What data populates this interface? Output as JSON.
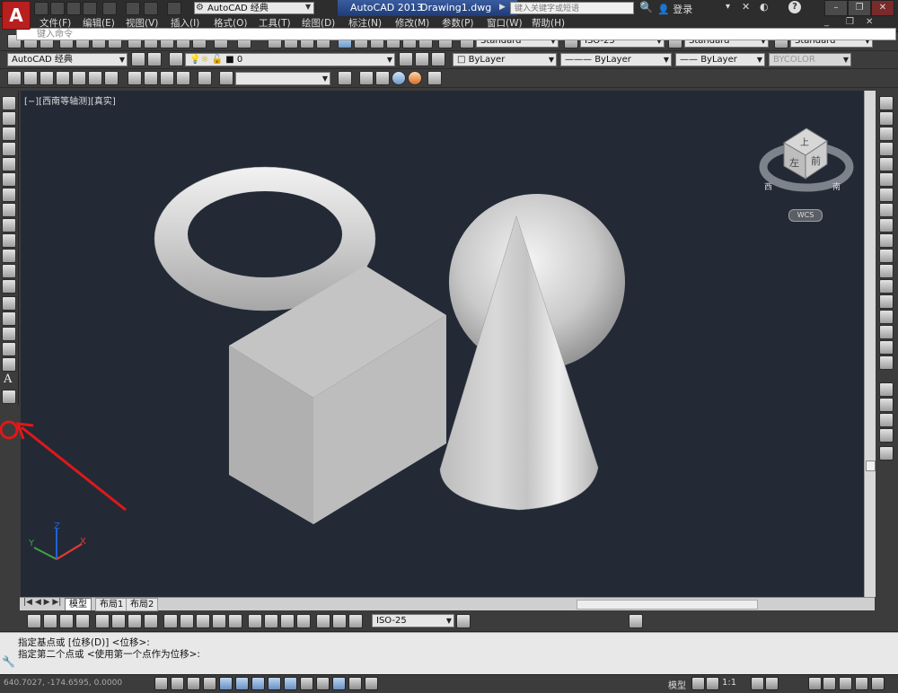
{
  "title_bar": {
    "app_logo": "A",
    "workspace": "AutoCAD 经典",
    "app_name": "AutoCAD 2013",
    "document_name": "Drawing1.dwg",
    "search_placeholder": "键入关键字或短语",
    "login_label": "登录",
    "help_label": "?"
  },
  "menu": {
    "items": [
      "文件(F)",
      "编辑(E)",
      "视图(V)",
      "插入(I)",
      "格式(O)",
      "工具(T)",
      "绘图(D)",
      "标注(N)",
      "修改(M)",
      "参数(P)",
      "窗口(W)",
      "帮助(H)"
    ]
  },
  "styles_toolbar": {
    "text_style": "Standard",
    "dim_style": "ISO-25",
    "table_style": "Standard",
    "multileader_style": "Standard"
  },
  "layers_toolbar": {
    "workspace": "AutoCAD 经典",
    "layer": "0",
    "color": "ByLayer",
    "linetype": "ByLayer",
    "lineweight": "ByLayer",
    "plotstyle": "BYCOLOR"
  },
  "viewport": {
    "label": "[−][西南等轴测][真实]",
    "viewcube_top": "上",
    "viewcube_left": "左",
    "viewcube_front": "前",
    "compass_west": "西",
    "compass_south": "南",
    "wcs_label": "WCS",
    "ucs_x": "X",
    "ucs_y": "Y",
    "ucs_z": "Z"
  },
  "tabs": {
    "model": "模型",
    "layout1": "布局1",
    "layout2": "布局2"
  },
  "dim_toolbar": {
    "dim_style": "ISO-25"
  },
  "command": {
    "line1": "指定基点或 [位移(D)] <位移>:",
    "line2": "指定第二个点或 <使用第一个点作为位移>:",
    "input_placeholder": "键入命令"
  },
  "status_bar": {
    "coords": "640.7027, -174.6595, 0.0000",
    "model_label": "模型",
    "scale_label": "1:1"
  },
  "colors": {
    "viewport_bg": "#232a36",
    "ui_dark": "#3c3c3c",
    "annotation_red": "#e01818",
    "axis_x": "#e53935",
    "axis_y": "#43a047",
    "axis_z": "#1e63d6"
  }
}
